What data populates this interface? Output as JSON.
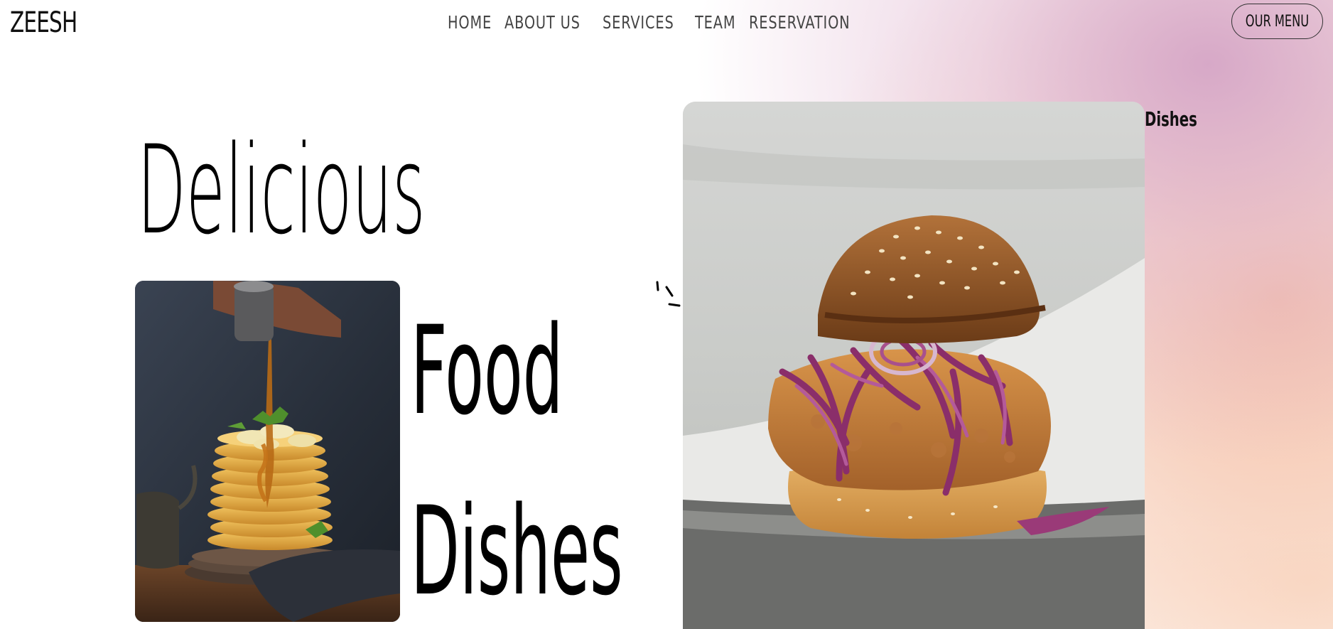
{
  "brand": {
    "logo": "ZEESH"
  },
  "nav": {
    "items": [
      {
        "label": "HOME"
      },
      {
        "label": "ABOUT US"
      },
      {
        "label": "SERVICES"
      },
      {
        "label": "TEAM"
      },
      {
        "label": "RESERVATION"
      }
    ],
    "cta_label": "OUR MENU"
  },
  "hero": {
    "word_1": "Delicious",
    "word_2": "Food",
    "word_3": "Dishes",
    "side_label": "Dishes"
  },
  "images": {
    "pancake": "pancake-stack-photo",
    "burger": "fried-chicken-burger-photo"
  },
  "colors": {
    "accent_pink": "#d5a5c6",
    "accent_peach": "#f2b296",
    "text": "#000000",
    "nav_text": "#444444"
  }
}
